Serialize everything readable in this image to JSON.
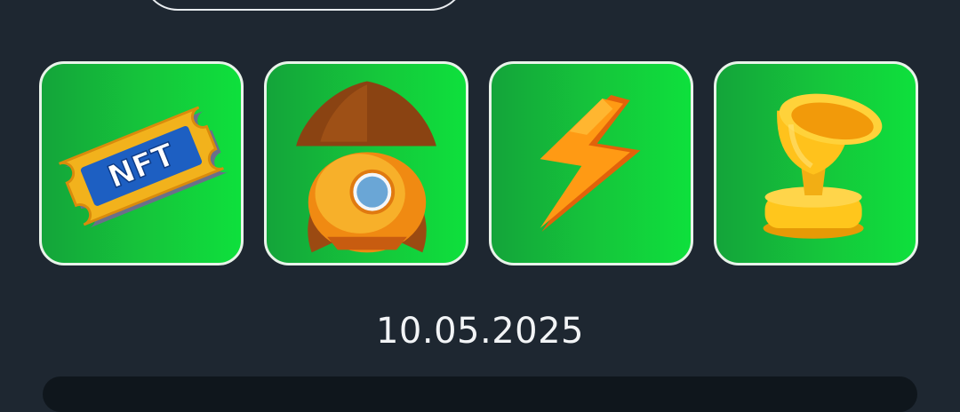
{
  "cards": [
    {
      "name": "nft-ticket",
      "text": "NFT"
    },
    {
      "name": "rocket"
    },
    {
      "name": "lightning"
    },
    {
      "name": "trophy"
    }
  ],
  "date": "10.05.2025",
  "colors": {
    "background": "#1e2731",
    "card_green": "#15c73b",
    "card_border": "#e9f3ea",
    "panel": "#0f161c"
  }
}
